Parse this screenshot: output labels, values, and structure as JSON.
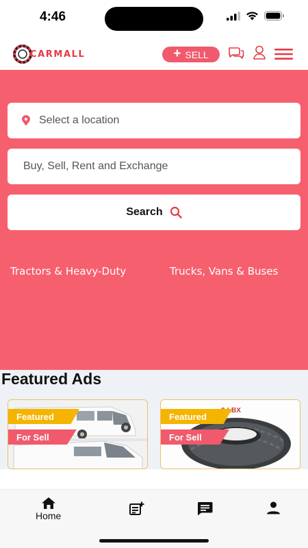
{
  "status_bar": {
    "time": "4:46"
  },
  "header": {
    "logo_text": "CARMALL",
    "sell_label": "SELL",
    "icons": [
      "chat-icon",
      "user-icon",
      "menu-icon"
    ]
  },
  "search": {
    "location_placeholder": "Select a location",
    "query_placeholder": "Buy, Sell, Rent and Exchange",
    "button_label": "Search"
  },
  "categories": [
    {
      "label": "Tractors & Heavy-Duty"
    },
    {
      "label": "Trucks, Vans & Buses"
    }
  ],
  "featured": {
    "title": "Featured Ads",
    "ads": [
      {
        "badge_featured": "Featured",
        "badge_status": "For Sell",
        "image": "white-van-photo"
      },
      {
        "badge_featured": "Featured",
        "badge_status": "For Sell",
        "image": "tire-photo",
        "plate_text": "2-LBX"
      }
    ]
  },
  "bottom_nav": {
    "items": [
      {
        "label": "Home",
        "icon": "home-icon",
        "active": true
      },
      {
        "label": "",
        "icon": "post-ad-icon"
      },
      {
        "label": "",
        "icon": "messages-icon"
      },
      {
        "label": "",
        "icon": "account-icon"
      }
    ]
  },
  "colors": {
    "brand": "#f6606e",
    "accent_red": "#e53945",
    "featured_badge": "#f5b400",
    "sale_badge": "#f05a6c"
  }
}
